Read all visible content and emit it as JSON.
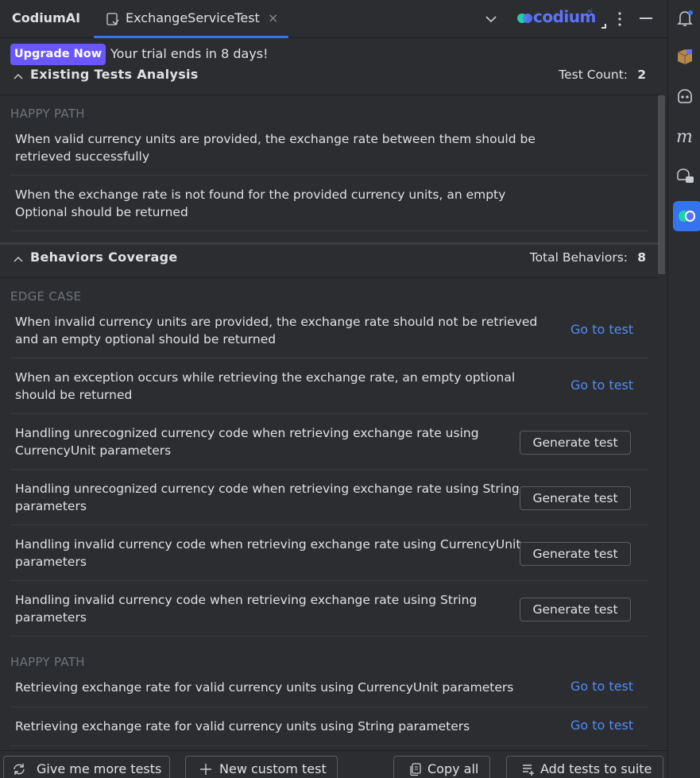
{
  "header": {
    "app_title": "CodiumAI",
    "tab_label": "ExchangeServiceTest",
    "tab_close": "×",
    "logo_text": "codium",
    "logo_sup": "ai"
  },
  "trial": {
    "upgrade_label": "Upgrade Now",
    "message": "Your trial ends in 8 days!"
  },
  "existing": {
    "title": "Existing Tests Analysis",
    "count_label": "Test Count:",
    "count_value": "2",
    "category": "HAPPY PATH",
    "items": [
      "When valid currency units are provided, the exchange rate between them should be retrieved successfully",
      "When the exchange rate is not found for the provided currency units, an empty Optional should be returned"
    ]
  },
  "behaviors": {
    "title": "Behaviors Coverage",
    "count_label": "Total Behaviors:",
    "count_value": "8",
    "edge_category": "EDGE CASE",
    "happy_category": "HAPPY PATH",
    "goto_label": "Go to test",
    "generate_label": "Generate test",
    "edge_items": [
      {
        "text": "When invalid currency units are provided, the exchange rate should not be retrieved and an empty optional should be returned",
        "action": "goto"
      },
      {
        "text": "When an exception occurs while retrieving the exchange rate, an empty optional should be returned",
        "action": "goto"
      },
      {
        "text": "Handling unrecognized currency code when retrieving exchange rate using CurrencyUnit parameters",
        "action": "generate"
      },
      {
        "text": "Handling unrecognized currency code when retrieving exchange rate using String parameters",
        "action": "generate"
      },
      {
        "text": "Handling invalid currency code when retrieving exchange rate using CurrencyUnit parameters",
        "action": "generate"
      },
      {
        "text": "Handling invalid currency code when retrieving exchange rate using String parameters",
        "action": "generate"
      }
    ],
    "happy_items": [
      {
        "text": "Retrieving exchange rate for valid currency units using CurrencyUnit parameters",
        "action": "goto"
      },
      {
        "text": "Retrieving exchange rate for valid currency units using String parameters",
        "action": "goto"
      }
    ]
  },
  "footer": {
    "more_tests": "Give me more tests",
    "custom_test": "New custom test",
    "copy_all": "Copy all",
    "add_to_suite": "Add tests to suite"
  },
  "icons": {
    "right_bar": [
      "notifications-icon",
      "package-icon",
      "ai-assistant-icon",
      "m-plugin-icon",
      "chat-icon",
      "codium-icon"
    ]
  },
  "colors": {
    "background": "#2b2d30",
    "accent": "#3574f0",
    "upgrade": "#6b57ff",
    "link": "#548af7",
    "brand": "#5d73ff"
  }
}
